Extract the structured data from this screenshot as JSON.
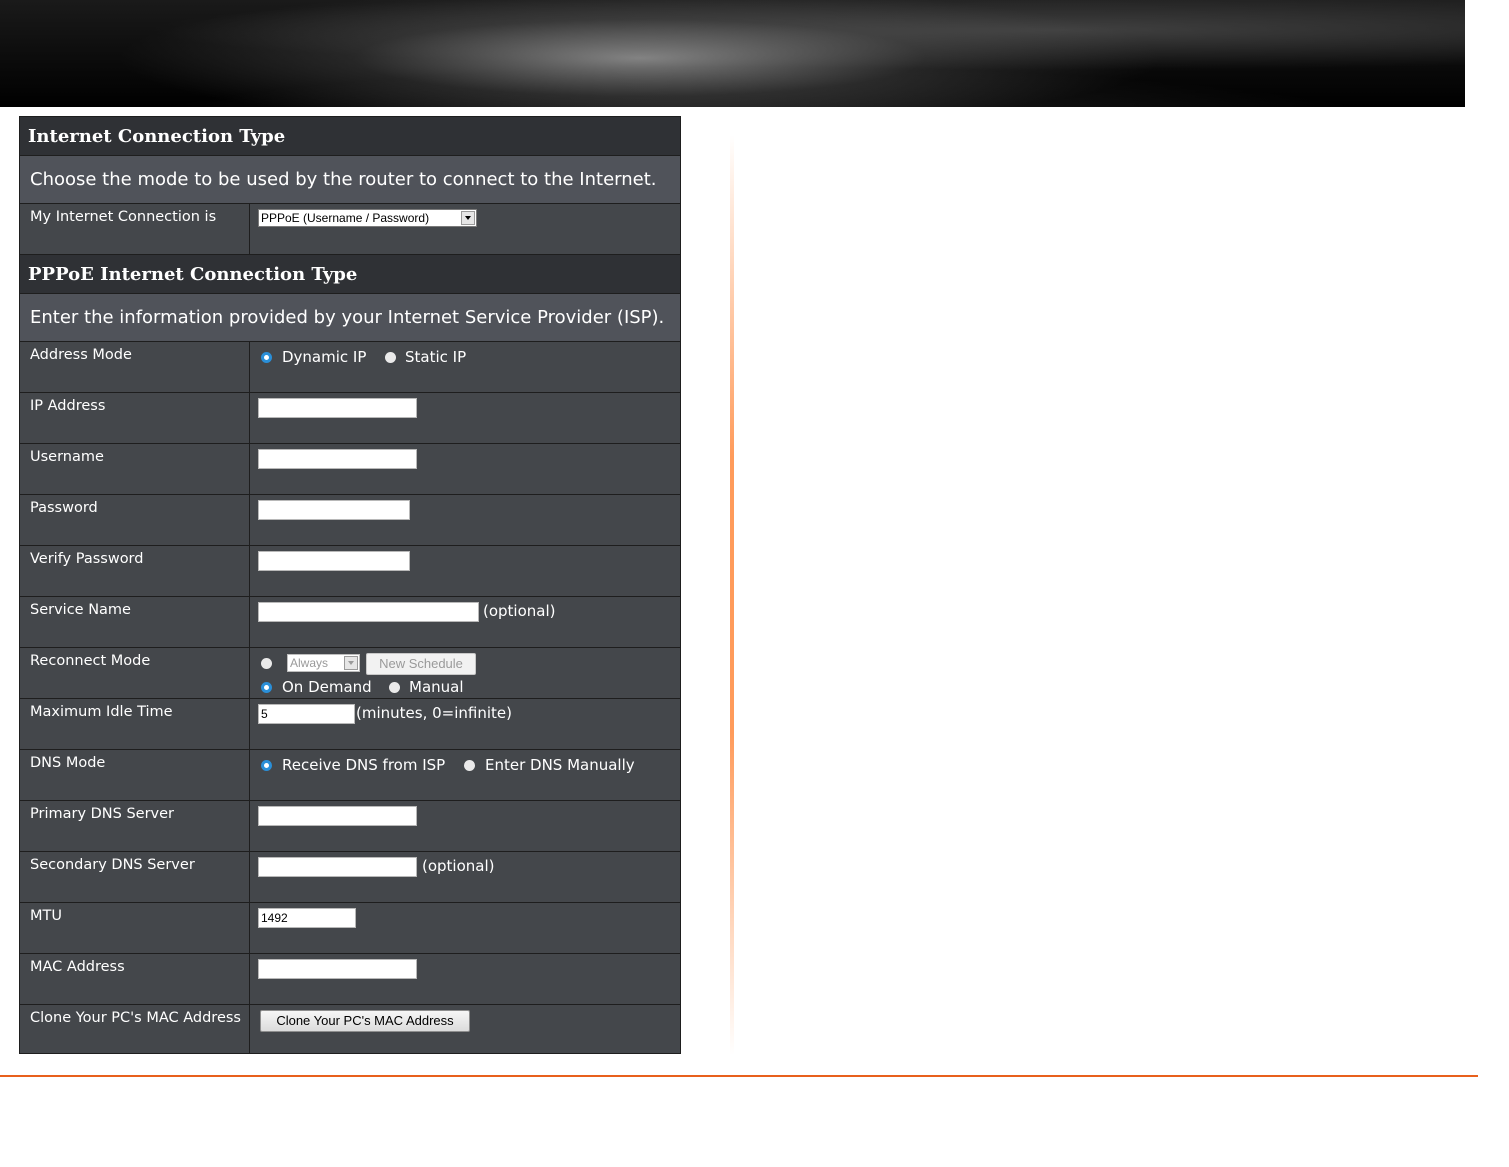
{
  "section1": {
    "title": "Internet Connection Type",
    "description": "Choose the mode to be used by the router to connect to the Internet.",
    "connection_label": "My Internet Connection is",
    "connection_value": "PPPoE (Username / Password)"
  },
  "section2": {
    "title": "PPPoE Internet Connection Type",
    "description": "Enter the information provided by your Internet Service Provider (ISP).",
    "rows": {
      "address_mode": {
        "label": "Address Mode",
        "opt1": "Dynamic IP",
        "opt2": "Static IP"
      },
      "ip_address": {
        "label": "IP Address",
        "value": ""
      },
      "username": {
        "label": "Username",
        "value": ""
      },
      "password": {
        "label": "Password",
        "value": ""
      },
      "verify_password": {
        "label": "Verify Password",
        "value": ""
      },
      "service_name": {
        "label": "Service Name",
        "value": "",
        "suffix": "(optional)"
      },
      "reconnect_mode": {
        "label": "Reconnect Mode",
        "schedule_value": "Always",
        "schedule_button": "New Schedule",
        "opt_on_demand": "On Demand",
        "opt_manual": "Manual"
      },
      "max_idle_time": {
        "label": "Maximum Idle Time",
        "value": "5",
        "suffix": "(minutes, 0=infinite)"
      },
      "dns_mode": {
        "label": "DNS Mode",
        "opt1": "Receive DNS from ISP",
        "opt2": "Enter DNS Manually"
      },
      "primary_dns": {
        "label": "Primary DNS Server",
        "value": ""
      },
      "secondary_dns": {
        "label": "Secondary DNS Server",
        "value": "",
        "suffix": "(optional)"
      },
      "mtu": {
        "label": "MTU",
        "value": "1492"
      },
      "mac_address": {
        "label": "MAC Address",
        "value": ""
      },
      "clone_mac": {
        "label": "Clone Your PC's MAC Address",
        "button": "Clone Your PC's MAC Address"
      }
    }
  },
  "colors": {
    "accent_line": "#e8601c",
    "radio_selected": "#2a8fd8",
    "panel_bg": "#44474b"
  }
}
